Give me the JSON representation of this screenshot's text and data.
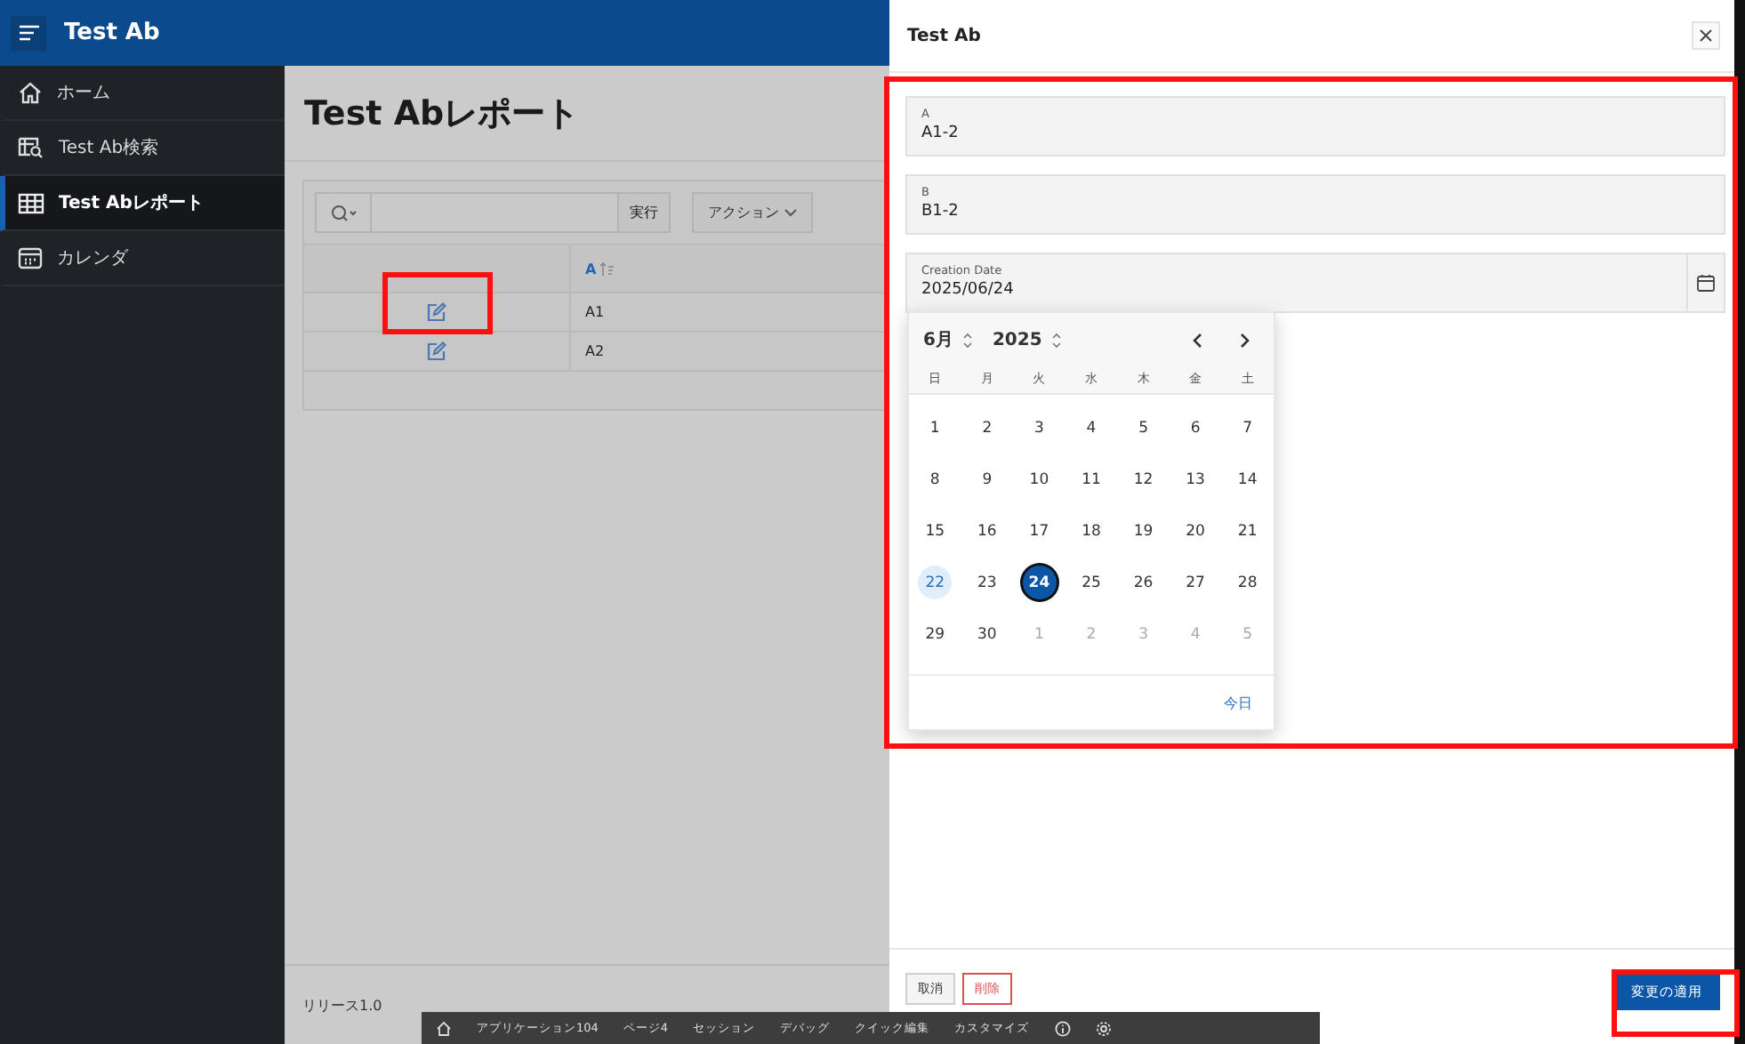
{
  "header": {
    "title": "Test Ab"
  },
  "sidebar": {
    "items": [
      {
        "label": "ホーム",
        "kind": "home",
        "selected": false
      },
      {
        "label": "Test Ab検索",
        "kind": "search-report",
        "selected": false
      },
      {
        "label": "Test Abレポート",
        "kind": "table",
        "selected": true
      },
      {
        "label": "カレンダ",
        "kind": "calendar",
        "selected": false
      }
    ]
  },
  "page": {
    "title": "Test Abレポート",
    "footer": "リリース1.0"
  },
  "report": {
    "go_button": "実行",
    "actions_button": "アクション",
    "columns": [
      {
        "label": "A",
        "sorted": true
      }
    ],
    "rows": [
      {
        "cell": "A1",
        "highlighted": true
      },
      {
        "cell": "A2",
        "highlighted": false
      }
    ]
  },
  "dialog": {
    "title": "Test Ab",
    "fields": [
      {
        "label": "A",
        "value": "A1-2",
        "kind": "text"
      },
      {
        "label": "B",
        "value": "B1-2",
        "kind": "text"
      },
      {
        "label": "Creation Date",
        "value": "2025/06/24",
        "kind": "date"
      }
    ],
    "calendar": {
      "month": "6月",
      "year": "2025",
      "weekdays": [
        "日",
        "月",
        "火",
        "水",
        "木",
        "金",
        "土"
      ],
      "today_button": "今日",
      "weeks": [
        [
          {
            "label": "1",
            "outside": false,
            "today": false,
            "selected": false
          },
          {
            "label": "2",
            "outside": false,
            "today": false,
            "selected": false
          },
          {
            "label": "3",
            "outside": false,
            "today": false,
            "selected": false
          },
          {
            "label": "4",
            "outside": false,
            "today": false,
            "selected": false
          },
          {
            "label": "5",
            "outside": false,
            "today": false,
            "selected": false
          },
          {
            "label": "6",
            "outside": false,
            "today": false,
            "selected": false
          },
          {
            "label": "7",
            "outside": false,
            "today": false,
            "selected": false
          }
        ],
        [
          {
            "label": "8",
            "outside": false,
            "today": false,
            "selected": false
          },
          {
            "label": "9",
            "outside": false,
            "today": false,
            "selected": false
          },
          {
            "label": "10",
            "outside": false,
            "today": false,
            "selected": false
          },
          {
            "label": "11",
            "outside": false,
            "today": false,
            "selected": false
          },
          {
            "label": "12",
            "outside": false,
            "today": false,
            "selected": false
          },
          {
            "label": "13",
            "outside": false,
            "today": false,
            "selected": false
          },
          {
            "label": "14",
            "outside": false,
            "today": false,
            "selected": false
          }
        ],
        [
          {
            "label": "15",
            "outside": false,
            "today": false,
            "selected": false
          },
          {
            "label": "16",
            "outside": false,
            "today": false,
            "selected": false
          },
          {
            "label": "17",
            "outside": false,
            "today": false,
            "selected": false
          },
          {
            "label": "18",
            "outside": false,
            "today": false,
            "selected": false
          },
          {
            "label": "19",
            "outside": false,
            "today": false,
            "selected": false
          },
          {
            "label": "20",
            "outside": false,
            "today": false,
            "selected": false
          },
          {
            "label": "21",
            "outside": false,
            "today": false,
            "selected": false
          }
        ],
        [
          {
            "label": "22",
            "outside": false,
            "today": true,
            "selected": false
          },
          {
            "label": "23",
            "outside": false,
            "today": false,
            "selected": false
          },
          {
            "label": "24",
            "outside": false,
            "today": false,
            "selected": true
          },
          {
            "label": "25",
            "outside": false,
            "today": false,
            "selected": false
          },
          {
            "label": "26",
            "outside": false,
            "today": false,
            "selected": false
          },
          {
            "label": "27",
            "outside": false,
            "today": false,
            "selected": false
          },
          {
            "label": "28",
            "outside": false,
            "today": false,
            "selected": false
          }
        ],
        [
          {
            "label": "29",
            "outside": false,
            "today": false,
            "selected": false
          },
          {
            "label": "30",
            "outside": false,
            "today": false,
            "selected": false
          },
          {
            "label": "1",
            "outside": true,
            "today": false,
            "selected": false
          },
          {
            "label": "2",
            "outside": true,
            "today": false,
            "selected": false
          },
          {
            "label": "3",
            "outside": true,
            "today": false,
            "selected": false
          },
          {
            "label": "4",
            "outside": true,
            "today": false,
            "selected": false
          },
          {
            "label": "5",
            "outside": true,
            "today": false,
            "selected": false
          }
        ]
      ]
    },
    "buttons": [
      {
        "label": "取消",
        "kind": "plain"
      },
      {
        "label": "削除",
        "kind": "danger"
      },
      {
        "label": "変更の適用",
        "kind": "primary"
      }
    ]
  },
  "dev_toolbar": {
    "items": [
      {
        "label": "アプリケーション104"
      },
      {
        "label": "ページ4"
      },
      {
        "label": "セッション"
      },
      {
        "label": "デバッグ"
      },
      {
        "label": "クイック編集"
      },
      {
        "label": "カスタマイズ"
      }
    ]
  }
}
